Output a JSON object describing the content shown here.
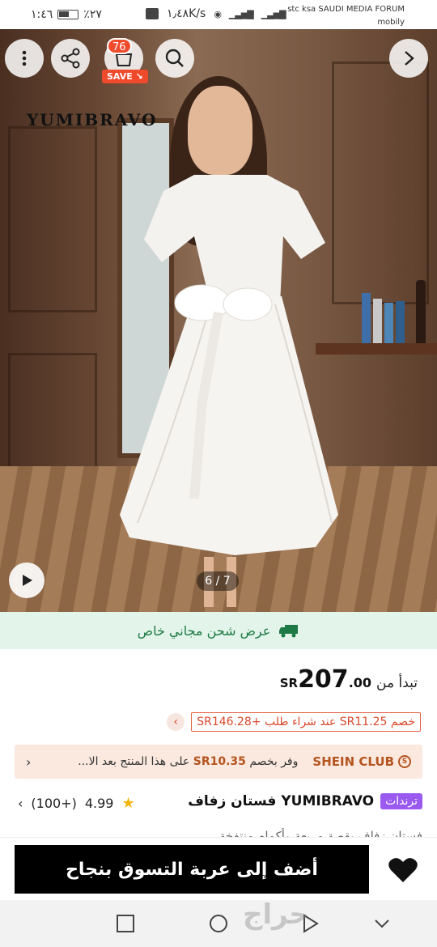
{
  "status_bar": {
    "time": "١:٤٦",
    "battery": "٪٢٧",
    "speed": "١٫٤٨K/s",
    "carrier_line1": "stc ksa SAUDI MEDIA FORUM",
    "carrier_line2": "mobily"
  },
  "hero": {
    "cart_count": "76",
    "save_label": "SAVE",
    "brand_logo": "YUMIBRAVO",
    "image_counter": "6 / 7"
  },
  "shipping_banner": {
    "text": "عرض شحن مجاني خاص"
  },
  "price": {
    "prefix": "تبدأ من",
    "currency": "SR",
    "integer": "207",
    "decimal": ".00"
  },
  "discount": {
    "text": "خصم SR11.25 عند شراء طلب +SR146.28"
  },
  "shein_club": {
    "logo_text": "SHEIN CLUB",
    "text_pre": "وفر بخصم ",
    "amount": "SR10.35",
    "text_post": " على هذا المنتج بعد الا..."
  },
  "product": {
    "trend_badge": "ترندات",
    "title": "YUMIBRAVO فستان زفاف",
    "rating": "4.99",
    "reviews": "(100+)",
    "description_peek": "فستان زفاف بقصة مربعة وأكمام منتفخة"
  },
  "action_bar": {
    "add_to_cart": "أضف إلى عربة التسوق بنجاح"
  },
  "watermark": "حراج",
  "colors": {
    "accent_red": "#f04a2c",
    "ship_green": "#1d7a45",
    "ship_bg": "#e3f4ea",
    "club_bg": "#fbe9df",
    "trend_purple": "#9a5af0"
  }
}
